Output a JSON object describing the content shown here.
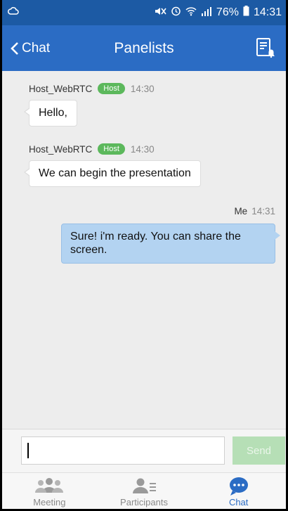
{
  "status_bar": {
    "battery": "76%",
    "time": "14:31"
  },
  "app_bar": {
    "back_label": "Chat",
    "title": "Panelists"
  },
  "messages": [
    {
      "sender": "Host_WebRTC",
      "badge": "Host",
      "time": "14:30",
      "text": "Hello,"
    },
    {
      "sender": "Host_WebRTC",
      "badge": "Host",
      "time": "14:30",
      "text": "We can begin the presentation"
    },
    {
      "sender": "Me",
      "time": "14:31",
      "text": "Sure! i'm ready. You can share the screen."
    }
  ],
  "composer": {
    "value": "",
    "send_label": "Send"
  },
  "tabs": [
    {
      "label": "Meeting",
      "icon": "meeting-icon"
    },
    {
      "label": "Participants",
      "icon": "participants-icon"
    },
    {
      "label": "Chat",
      "icon": "chat-icon",
      "active": true
    }
  ],
  "colors": {
    "status_bar": "#1c5aa4",
    "app_bar": "#2b6cc4",
    "host_badge": "#5cb85c",
    "out_bubble": "#b3d3f1",
    "send_button": "#b6dfb6"
  }
}
